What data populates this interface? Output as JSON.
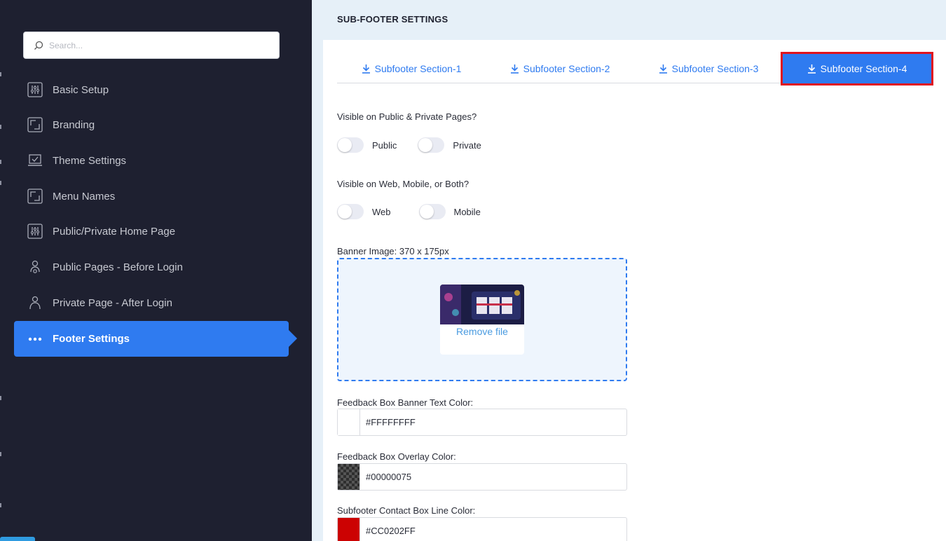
{
  "sidebar": {
    "search_placeholder": "Search...",
    "items": [
      {
        "label": "Basic Setup",
        "icon": "sliders-icon"
      },
      {
        "label": "Branding",
        "icon": "frame-icon"
      },
      {
        "label": "Theme Settings",
        "icon": "laptop-check-icon"
      },
      {
        "label": "Menu Names",
        "icon": "frame-icon"
      },
      {
        "label": "Public/Private Home Page",
        "icon": "sliders-icon"
      },
      {
        "label": "Public Pages - Before Login",
        "icon": "user-gear-icon"
      },
      {
        "label": "Private Page - After Login",
        "icon": "user-icon"
      },
      {
        "label": "Footer Settings",
        "icon": "dots-icon",
        "active": true
      }
    ]
  },
  "main": {
    "title": "SUB-FOOTER SETTINGS",
    "tabs": [
      {
        "label": "Subfooter Section-1"
      },
      {
        "label": "Subfooter Section-2"
      },
      {
        "label": "Subfooter Section-3"
      },
      {
        "label": "Subfooter Section-4",
        "active": true
      }
    ],
    "visibility_pages": {
      "label": "Visible on Public & Private Pages?",
      "options": [
        "Public",
        "Private"
      ]
    },
    "visibility_devices": {
      "label": "Visible on Web, Mobile, or Both?",
      "options": [
        "Web",
        "Mobile"
      ]
    },
    "banner": {
      "label": "Banner Image: 370 x 175px",
      "remove_label": "Remove file"
    },
    "colors": [
      {
        "label": "Feedback Box Banner Text Color:",
        "value": "#FFFFFFFF",
        "swatch": "#ffffff"
      },
      {
        "label": "Feedback Box Overlay Color:",
        "value": "#00000075",
        "swatch": "checker"
      },
      {
        "label": "Subfooter Contact Box Line Color:",
        "value": "#CC0202FF",
        "swatch": "#cc0202"
      }
    ]
  },
  "theme": {
    "accent": "#2f7bf0",
    "sidebar_bg": "#1e2030",
    "highlight_outline": "#e0141e"
  }
}
